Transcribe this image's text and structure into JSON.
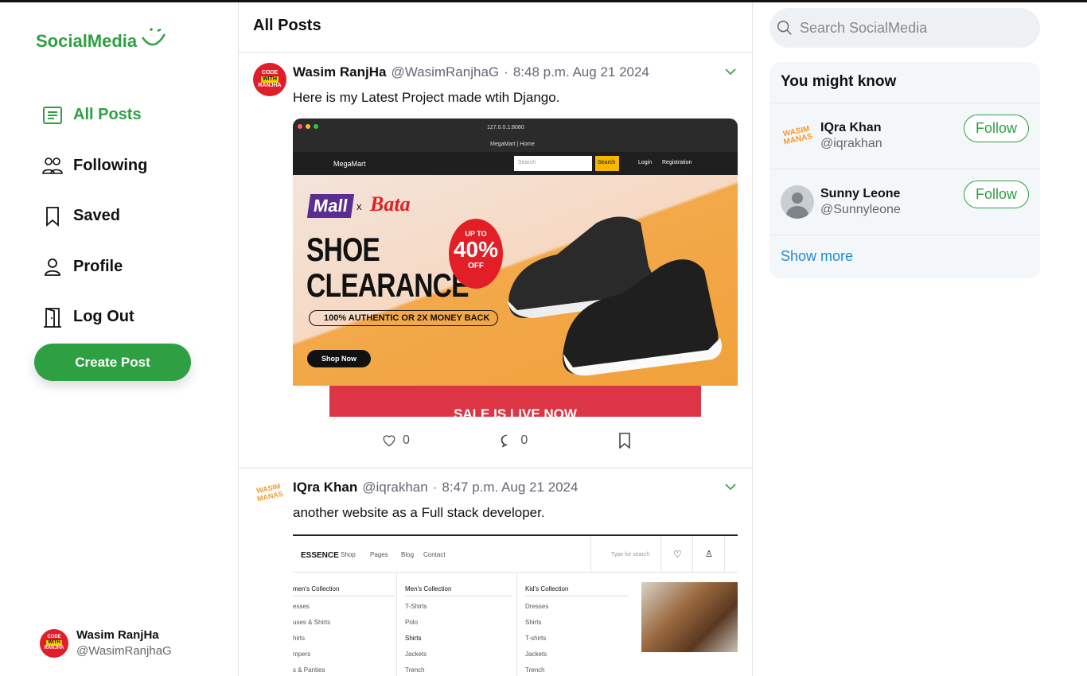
{
  "app": {
    "name": "SocialMedia"
  },
  "nav": {
    "all_posts": "All Posts",
    "following": "Following",
    "saved": "Saved",
    "profile": "Profile",
    "logout": "Log Out",
    "create_post": "Create Post"
  },
  "me": {
    "name": "Wasim RanjHa",
    "handle": "@WasimRanjhaG"
  },
  "feed": {
    "title": "All Posts"
  },
  "posts": [
    {
      "name": "Wasim RanjHa",
      "handle": "@WasimRanjhaG",
      "time": "8:48 p.m. Aug 21 2024",
      "text": "Here is my Latest Project made wtih Django.",
      "likes": "0",
      "comments": "0",
      "image": {
        "url": "127.0.0.1:8080",
        "tab": "MegaMart | Home",
        "brand": "MegaMart",
        "search_placeholder": "Search",
        "search_btn": "Search",
        "login": "Login",
        "registration": "Registration",
        "mall": "Mall",
        "x": "x",
        "bata": "Bata",
        "headline1": "SHOE",
        "headline2": "CLEARANCE",
        "upto": "UP TO",
        "pct": "40%",
        "off": "OFF",
        "authentic": "100% AUTHENTIC OR 2X MONEY BACK",
        "shop": "Shop Now",
        "sale": "SALE IS LIVE NOW"
      }
    },
    {
      "name": "IQra Khan",
      "handle": "@iqrakhan",
      "time": "8:47 p.m. Aug 21 2024",
      "text": "another website as a Full stack developer.",
      "image": {
        "brand": "ESSENCE",
        "menu": [
          "Shop",
          "Pages",
          "Blog",
          "Contact"
        ],
        "search": "Type for search",
        "cols": [
          {
            "title": "men's Collection",
            "items": [
              "esses",
              "uses & Shirts",
              "hirts",
              "mpers",
              "s & Panties"
            ]
          },
          {
            "title": "Men's Collection",
            "items": [
              "T-Shirts",
              "Polo",
              "Shirts",
              "Jackets",
              "Trench"
            ]
          },
          {
            "title": "Kid's Collection",
            "items": [
              "Dresses",
              "Shirts",
              "T-shirts",
              "Jackets",
              "Trench"
            ]
          }
        ]
      }
    }
  ],
  "search": {
    "placeholder": "Search SocialMedia"
  },
  "suggest": {
    "title": "You might know",
    "people": [
      {
        "name": "IQra Khan",
        "handle": "@iqrakhan",
        "button": "Follow"
      },
      {
        "name": "Sunny Leone",
        "handle": "@Sunnyleone",
        "button": "Follow"
      }
    ],
    "more": "Show more"
  },
  "colors": {
    "accent": "#2ea043",
    "link": "#1d8bd6"
  }
}
